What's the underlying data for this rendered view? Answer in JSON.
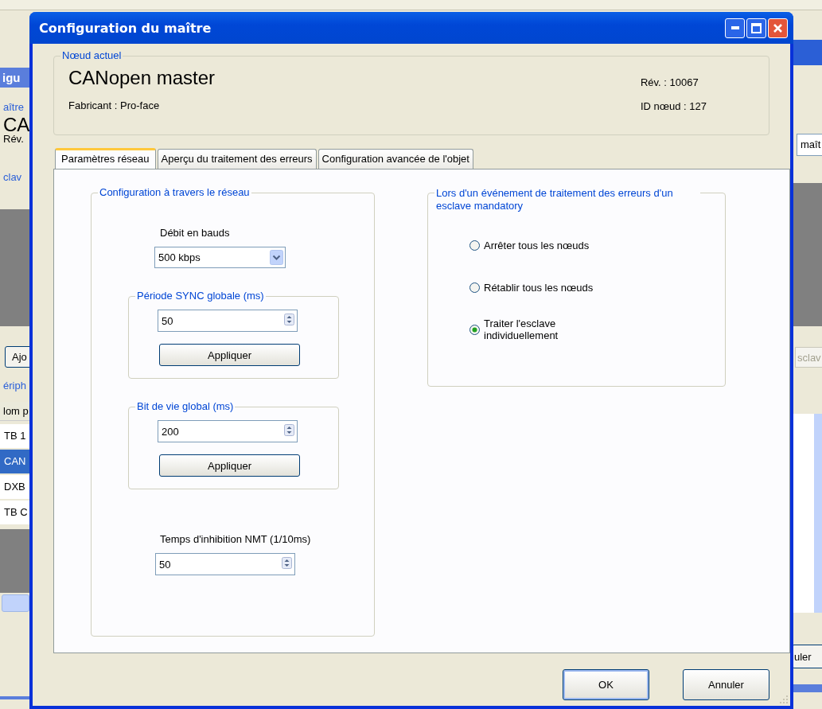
{
  "background_left": {
    "title": "igu",
    "master_link": "aître",
    "name": "CA",
    "revision": "Rév.",
    "slaves_label": "clav",
    "add_button": "Ajo",
    "devices_label": "ériph",
    "column_header": "lom p",
    "rows": [
      {
        "text": "TB 1",
        "selected": false
      },
      {
        "text": "CAN",
        "selected": true
      },
      {
        "text": "DXB",
        "selected": false
      },
      {
        "text": "TB C",
        "selected": false
      }
    ]
  },
  "background_right": {
    "field": "maît",
    "slaves_button": "sclav",
    "cancel_button": "uler"
  },
  "dialog": {
    "title": "Configuration du maître"
  },
  "current_node": {
    "legend": "Nœud actuel",
    "name": "CANopen master",
    "manufacturer": "Fabricant : Pro-face",
    "revision": "Rév. : 10067",
    "node_id": "ID nœud : 127"
  },
  "tabs": [
    {
      "label": "Paramètres réseau",
      "selected": true
    },
    {
      "label": "Aperçu du traitement des erreurs",
      "selected": false
    },
    {
      "label": "Configuration avancée de l'objet",
      "selected": false
    }
  ],
  "network_group": {
    "legend": "Configuration à travers le réseau",
    "baud_label": "Débit en bauds",
    "baud_value": "500 kbps",
    "sync_group": {
      "legend": "Période SYNC globale (ms)",
      "value": "50",
      "button": "Appliquer"
    },
    "life_group": {
      "legend": "Bit de vie global (ms)",
      "value": "200",
      "button": "Appliquer"
    },
    "nmt_label": "Temps d'inhibition NMT (1/10ms)",
    "nmt_value": "50"
  },
  "error_group": {
    "legend": "Lors d'un événement de traitement des erreurs d'un esclave mandatory",
    "options": [
      {
        "label": "Arrêter tous les nœuds",
        "selected": false
      },
      {
        "label": "Rétablir tous les nœuds",
        "selected": false
      },
      {
        "label": "Traiter l'esclave individuellement",
        "selected": true
      }
    ]
  },
  "buttons": [
    {
      "label": "OK",
      "default": true
    },
    {
      "label": "Annuler",
      "default": false
    }
  ]
}
